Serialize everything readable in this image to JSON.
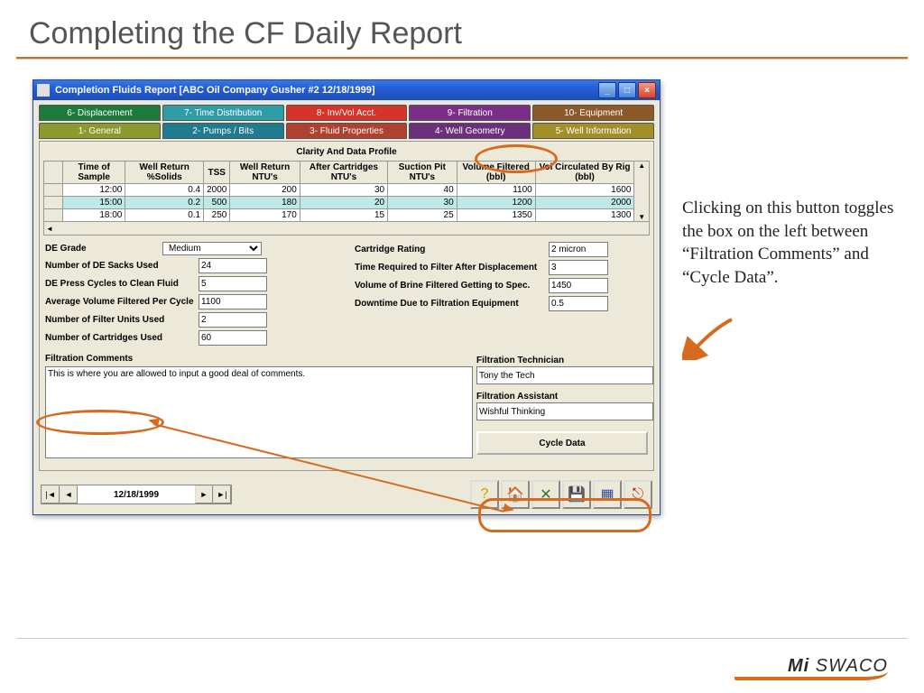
{
  "slide": {
    "title": "Completing the CF Daily Report"
  },
  "window_title": "Completion Fluids Report [ABC Oil Company  Gusher #2  12/18/1999]",
  "tabs_top": [
    {
      "label": "6- Displacement",
      "cls": "t-disp"
    },
    {
      "label": "7- Time Distribution",
      "cls": "t-time"
    },
    {
      "label": "8- Inv/Vol Acct.",
      "cls": "t-inv"
    },
    {
      "label": "9- Filtration",
      "cls": "t-filt"
    },
    {
      "label": "10- Equipment",
      "cls": "t-equip"
    }
  ],
  "tabs_bot": [
    {
      "label": "1- General",
      "cls": "t-gen"
    },
    {
      "label": "2- Pumps / Bits",
      "cls": "t-pump"
    },
    {
      "label": "3- Fluid Properties",
      "cls": "t-fluid"
    },
    {
      "label": "4- Well Geometry",
      "cls": "t-wellg"
    },
    {
      "label": "5- Well Information",
      "cls": "t-winfo"
    }
  ],
  "grid": {
    "title": "Clarity And Data Profile",
    "headers": [
      "Time of Sample",
      "Well Return %Solids",
      "TSS",
      "Well Return NTU's",
      "After Cartridges NTU's",
      "Suction Pit NTU's",
      "Volume Filtered (bbl)",
      "Vol Circulated By Rig (bbl)"
    ],
    "rows": [
      [
        "12:00",
        "0.4",
        "2000",
        "200",
        "30",
        "40",
        "1100",
        "1600"
      ],
      [
        "15:00",
        "0.2",
        "500",
        "180",
        "20",
        "30",
        "1200",
        "2000"
      ],
      [
        "18:00",
        "0.1",
        "250",
        "170",
        "15",
        "25",
        "1350",
        "1300"
      ]
    ],
    "highlight_row": 1
  },
  "form_left": {
    "de_grade": {
      "label": "DE Grade",
      "value": "Medium"
    },
    "sacks": {
      "label": "Number of DE Sacks Used",
      "value": "24"
    },
    "cycles": {
      "label": "DE Press Cycles to Clean Fluid",
      "value": "5"
    },
    "avgvol": {
      "label": "Average Volume Filtered Per Cycle",
      "value": "1100"
    },
    "units": {
      "label": "Number of Filter Units Used",
      "value": "2"
    },
    "carts": {
      "label": "Number of Cartridges Used",
      "value": "60"
    }
  },
  "form_right": {
    "rating": {
      "label": "Cartridge Rating",
      "value": "2 micron"
    },
    "time": {
      "label": "Time Required to Filter After Displacement",
      "value": "3"
    },
    "brine": {
      "label": "Volume of Brine Filtered Getting to Spec.",
      "value": "1450"
    },
    "down": {
      "label": "Downtime Due to Filtration Equipment",
      "value": "0.5"
    }
  },
  "comments": {
    "heading": "Filtration Comments",
    "text": "This is where you are allowed to input a good deal of comments."
  },
  "personnel": {
    "tech_label": "Filtration Technician",
    "tech": "Tony the Tech",
    "assist_label": "Filtration Assistant",
    "assist": "Wishful Thinking"
  },
  "cycle_btn": "Cycle Data",
  "nav_date": "12/18/1999",
  "description": "Clicking on this button toggles the box on the left between “Filtration Comments” and “Cycle Data”.",
  "brand": {
    "a": "Mi",
    "b": "SWACO"
  }
}
